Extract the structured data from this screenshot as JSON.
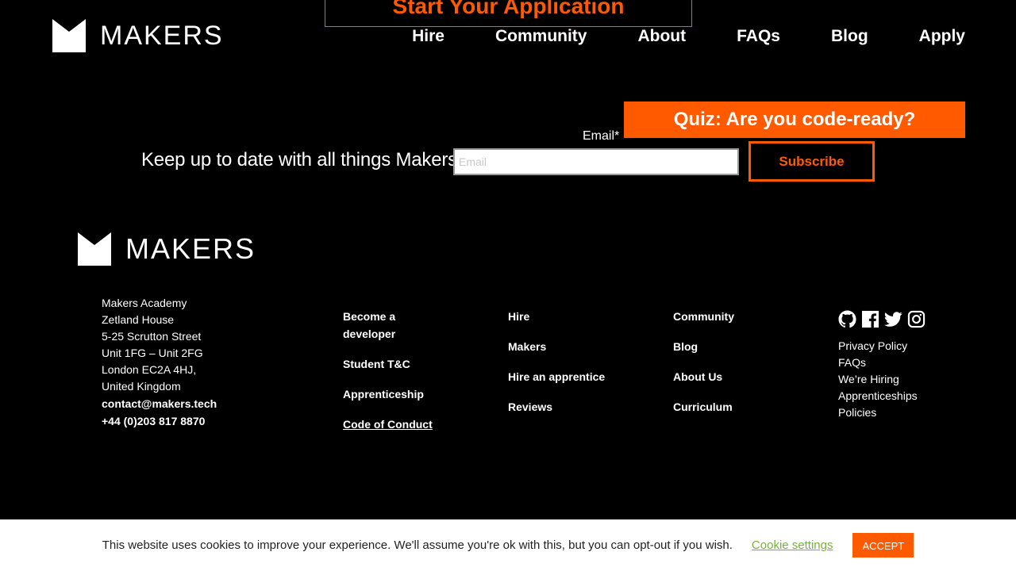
{
  "brand": {
    "name": "MAKERS",
    "logo_icon": "makers-crown-icon"
  },
  "header": {
    "apply_banner": "Start Your Application",
    "nav": [
      "Hire",
      "Community",
      "About",
      "FAQs",
      "Blog",
      "Apply"
    ]
  },
  "quiz": {
    "label": "Quiz: Are you code-ready?"
  },
  "newsletter": {
    "text": "Keep up to date with all things Makers",
    "email_label": "Email*",
    "email_placeholder": "Email",
    "email_value": "",
    "subscribe_label": "Subscribe"
  },
  "footer": {
    "address": [
      "Makers Academy",
      "Zetland House",
      "5-25 Scrutton Street",
      "Unit 1FG – Unit 2FG",
      "London EC2A 4HJ,",
      "United Kingdom"
    ],
    "email": "contact@makers.tech",
    "phone": "+44 (0)203 817 8870",
    "col1": [
      "Become a developer",
      "Student T&C",
      "Apprenticeship",
      "Code of Conduct"
    ],
    "col2": [
      "Hire",
      "Makers",
      "Hire an apprentice",
      "Reviews"
    ],
    "col3": [
      "Community",
      "Blog",
      "About Us",
      "Curriculum"
    ],
    "social_icons": [
      "github-icon",
      "facebook-icon",
      "twitter-icon",
      "instagram-icon"
    ],
    "legal": [
      "Privacy Policy",
      "FAQs",
      "We’re Hiring",
      "Apprenticeships",
      "Policies"
    ]
  },
  "cookie": {
    "message": "This website uses cookies to improve your experience. We'll assume you're ok with this, but you can opt-out if you wish.",
    "settings_label": "Cookie settings",
    "accept_label": "ACCEPT"
  },
  "colors": {
    "accent": "#ff5a00",
    "background": "#000000",
    "cookie_link": "#77b33a"
  }
}
